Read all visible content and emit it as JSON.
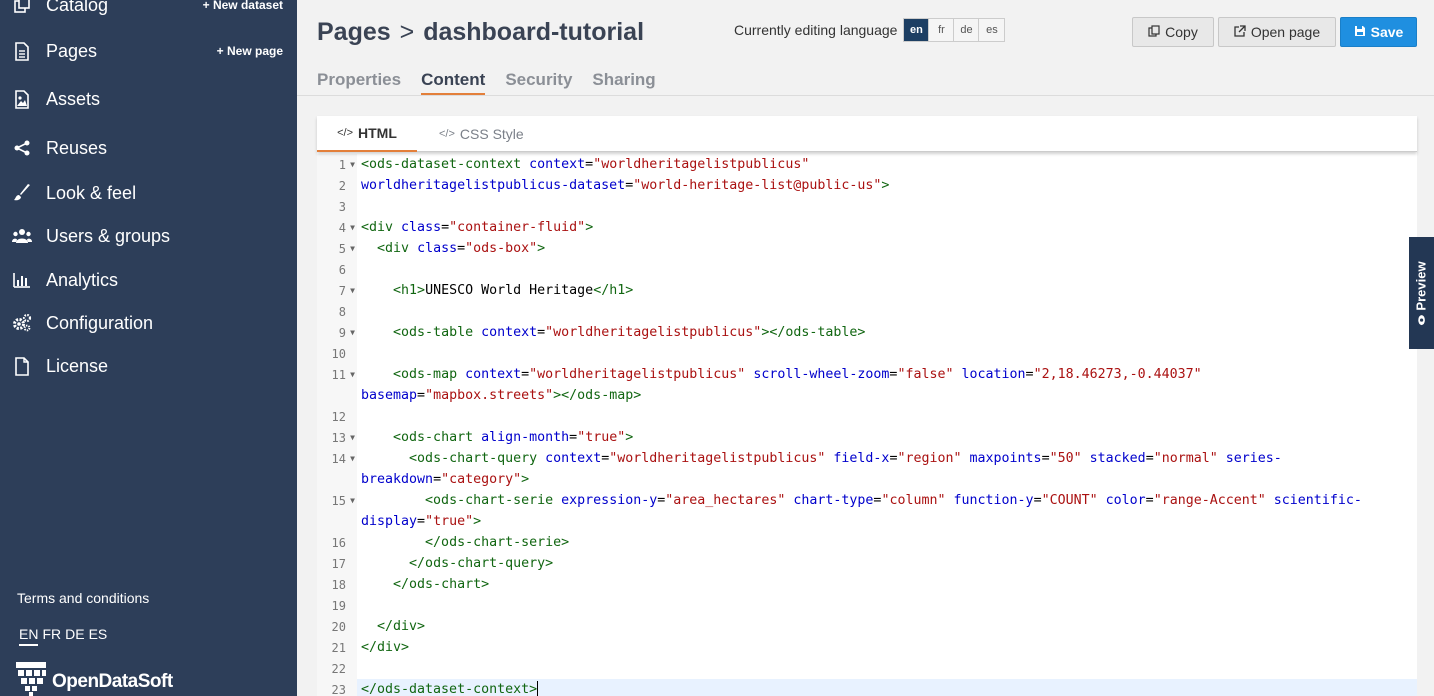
{
  "sidebar": {
    "items": [
      {
        "label": "Catalog",
        "extra": "+ New dataset",
        "icon": "copy-icon"
      },
      {
        "label": "Pages",
        "extra": "+ New page",
        "icon": "file-icon"
      },
      {
        "label": "Assets",
        "extra": "",
        "icon": "image-icon"
      },
      {
        "label": "Reuses",
        "extra": "",
        "icon": "share-icon"
      },
      {
        "label": "Look & feel",
        "extra": "",
        "icon": "brush-icon"
      },
      {
        "label": "Users & groups",
        "extra": "",
        "icon": "users-icon"
      },
      {
        "label": "Analytics",
        "extra": "",
        "icon": "bar-chart-icon"
      },
      {
        "label": "Configuration",
        "extra": "",
        "icon": "gears-icon"
      },
      {
        "label": "License",
        "extra": "",
        "icon": "file-icon"
      }
    ],
    "terms": "Terms and conditions",
    "languages": [
      "EN",
      "FR",
      "DE",
      "ES"
    ],
    "active_language": "EN",
    "brand": "OpenDataSoft"
  },
  "header": {
    "breadcrumb_root": "Pages",
    "separator": ">",
    "page_name": "dashboard-tutorial",
    "editing_label": "Currently editing language",
    "languages": [
      "en",
      "fr",
      "de",
      "es"
    ],
    "active_language": "en",
    "copy_label": "Copy",
    "open_label": "Open page",
    "save_label": "Save"
  },
  "tabs": [
    "Properties",
    "Content",
    "Security",
    "Sharing"
  ],
  "active_tab": "Content",
  "editor": {
    "html_tab": "HTML",
    "css_tab": "CSS Style",
    "code_icon": "</>",
    "active_line": 23
  },
  "preview_label": "Preview",
  "colors": {
    "sidebar_bg": "#2d3e59",
    "accent_orange": "#e37f3a",
    "save_blue": "#1f8fe0",
    "lang_active": "#1d3f63"
  }
}
